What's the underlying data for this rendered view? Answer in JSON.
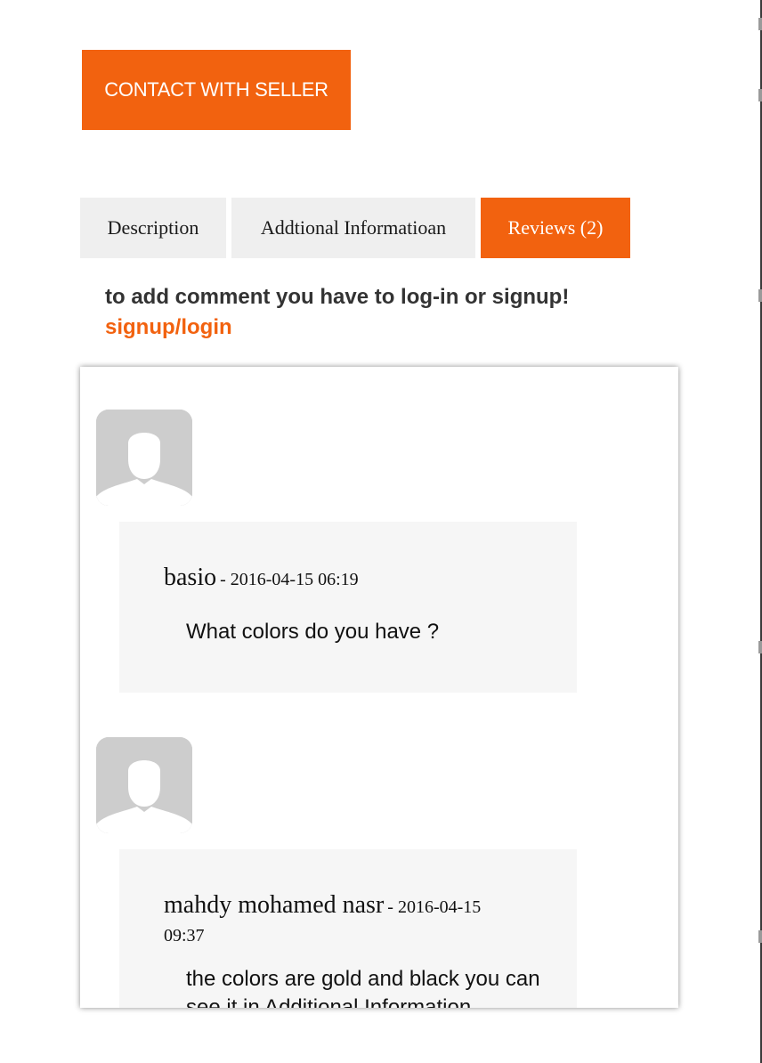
{
  "contact_button": "CONTACT WITH SELLER",
  "tabs": [
    {
      "label": "Description",
      "active": false
    },
    {
      "label": "Addtional Informatioan",
      "active": false
    },
    {
      "label": "Reviews (2)",
      "active": true
    }
  ],
  "login_notice": {
    "message": "to add comment you have to log-in or signup!",
    "link": "signup/login"
  },
  "reviews": [
    {
      "author": "basio",
      "date": "- 2016-04-15 06:19",
      "text": "What colors do you have ?",
      "avatar": "user-avatar-icon"
    },
    {
      "author": "mahdy mohamed nasr",
      "date": "- 2016-04-15 09:37",
      "text": "the colors are gold and black you can see it in Additional Information",
      "avatar": "user-avatar-icon"
    }
  ],
  "colors": {
    "accent": "#f2620f",
    "tab_bg": "#efefef",
    "bubble_bg": "#f6f6f6",
    "avatar_bg": "#cdcdcd"
  }
}
